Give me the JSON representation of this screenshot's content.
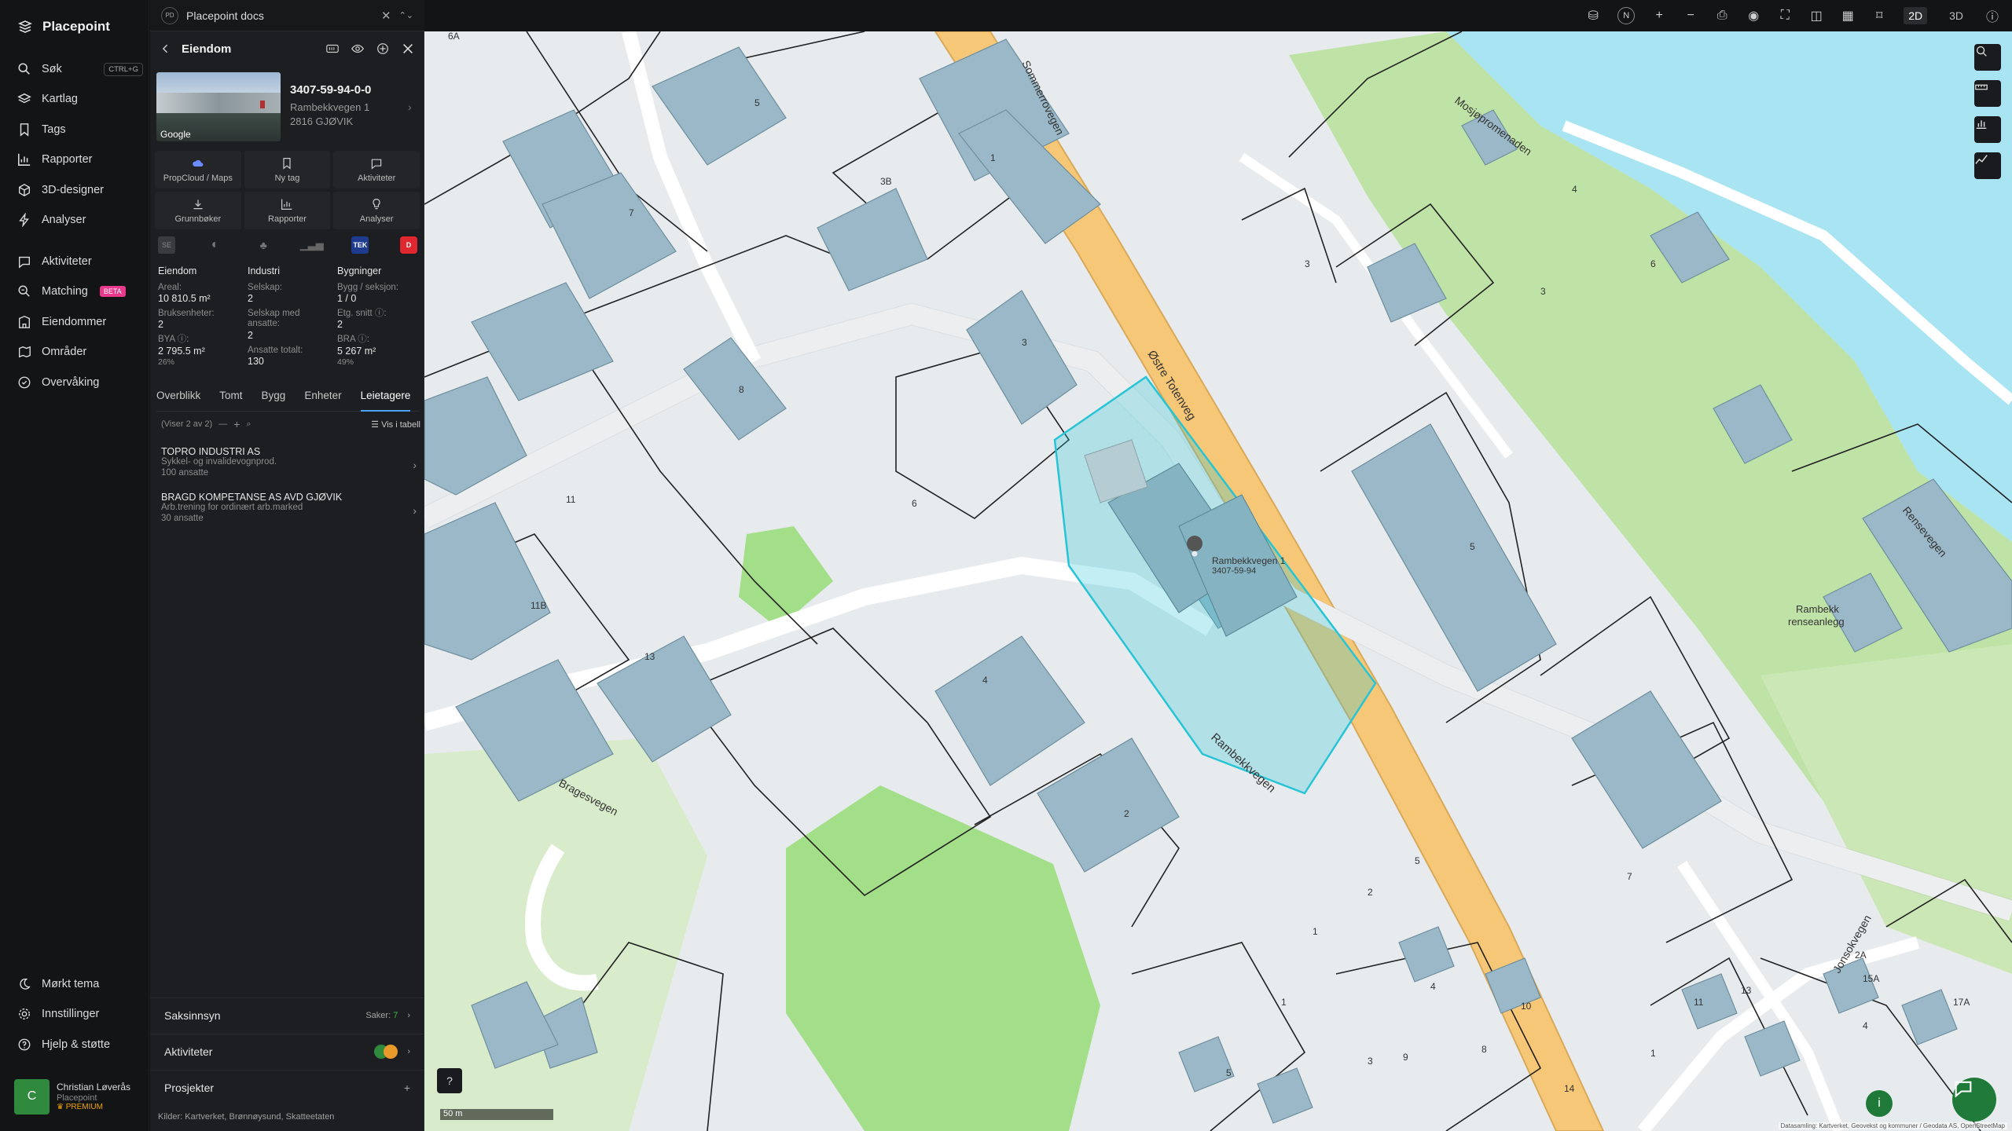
{
  "app": {
    "name": "Placepoint"
  },
  "nav": {
    "items": [
      {
        "label": "Søk",
        "icon": "search-icon",
        "shortcut": "CTRL+G"
      },
      {
        "label": "Kartlag",
        "icon": "layers-icon"
      },
      {
        "label": "Tags",
        "icon": "bookmark-icon"
      },
      {
        "label": "Rapporter",
        "icon": "chart-icon"
      },
      {
        "label": "3D-designer",
        "icon": "cube-icon"
      },
      {
        "label": "Analyser",
        "icon": "lightning-icon"
      },
      {
        "label": "Aktiviteter",
        "icon": "activity-icon"
      },
      {
        "label": "Matching",
        "icon": "matching-icon",
        "badge": "BETA"
      },
      {
        "label": "Eiendommer",
        "icon": "building-icon"
      },
      {
        "label": "Områder",
        "icon": "area-icon"
      },
      {
        "label": "Overvåking",
        "icon": "monitor-icon"
      }
    ],
    "bottom": [
      {
        "label": "Mørkt tema",
        "icon": "moon-icon"
      },
      {
        "label": "Innstillinger",
        "icon": "gear-icon"
      },
      {
        "label": "Hjelp & støtte",
        "icon": "help-icon"
      }
    ],
    "user": {
      "initial": "C",
      "name": "Christian Løverås",
      "org": "Placepoint",
      "plan": "PREMIUM"
    }
  },
  "panel": {
    "workspace": {
      "badge": "PD",
      "title": "Placepoint docs"
    },
    "header": {
      "title": "Eiendom"
    },
    "thumbnail": {
      "provider": "Google"
    },
    "property": {
      "id": "3407-59-94-0-0",
      "address": "Rambekkvegen 1",
      "postal": "2816 GJØVIK"
    },
    "actions": [
      {
        "label": "PropCloud / Maps",
        "icon": "cloud-icon"
      },
      {
        "label": "Ny tag",
        "icon": "bookmark-icon"
      },
      {
        "label": "Aktiviteter",
        "icon": "chat-icon"
      },
      {
        "label": "Grunnbøker",
        "icon": "download-icon"
      },
      {
        "label": "Rapporter",
        "icon": "chart-icon"
      },
      {
        "label": "Analyser",
        "icon": "lightbulb-icon"
      }
    ],
    "sources": {
      "tek": "TEK",
      "d": "D"
    },
    "facts": {
      "eiendom": {
        "title": "Eiendom",
        "areal_label": "Areal:",
        "areal_value": "10 810.5 m²",
        "bruksenheter_label": "Bruksenheter:",
        "bruksenheter_value": "2",
        "bya_label": "BYA ⓘ:",
        "bya_value": "2 795.5 m²",
        "bya_pct": "26%"
      },
      "industri": {
        "title": "Industri",
        "selskap_label": "Selskap:",
        "selskap_value": "2",
        "selskap_ansatte_label": "Selskap med ansatte:",
        "selskap_ansatte_value": "2",
        "ansatte_label": "Ansatte totalt:",
        "ansatte_value": "130"
      },
      "bygninger": {
        "title": "Bygninger",
        "bygg_label": "Bygg / seksjon:",
        "bygg_value": "1 / 0",
        "etg_label": "Etg. snitt ⓘ:",
        "etg_value": "2",
        "bra_label": "BRA ⓘ:",
        "bra_value": "5 267 m²",
        "bra_pct": "49%"
      }
    },
    "tabs": [
      "Overblikk",
      "Tomt",
      "Bygg",
      "Enheter",
      "Leietagere"
    ],
    "active_tab": "Leietagere",
    "list": {
      "count": "(Viser 2 av 2)",
      "table_link": "Vis i tabell"
    },
    "tenants": [
      {
        "name": "TOPRO INDUSTRI AS",
        "desc": "Sykkel- og invalidevognprod.",
        "employees": "100 ansatte"
      },
      {
        "name": "BRAGD KOMPETANSE AS AVD GJØVIK",
        "desc": "Arb.trening for ordinært arb.marked",
        "employees": "30 ansatte"
      }
    ],
    "sections": {
      "saksinnsyn": {
        "label": "Saksinnsyn",
        "count_label": "Saker:",
        "count": "7"
      },
      "aktiviteter": {
        "label": "Aktiviteter"
      },
      "prosjekter": {
        "label": "Prosjekter"
      }
    },
    "footer": {
      "label": "Kilder:",
      "sources": [
        "Kartverket,",
        "Brønnøysund,",
        "Skatteetaten"
      ]
    }
  },
  "topbar": {
    "north": "N",
    "mode_2d": "2D",
    "mode_3d": "3D"
  },
  "map": {
    "scale": "50 m",
    "attribution": "Datasamling: Kartverket, Geovekst og kommuner / Geodata AS, OpenStreetMap",
    "roads": [
      "Østre Totenveg",
      "Rambekkvegen",
      "Sommerrovegen",
      "Bragesvegen",
      "Mosjøpromenaden",
      "Rensevegen",
      "Jonsokvegen"
    ],
    "selected_label": "Rambekkvegen 1",
    "selected_sublabel": "3407-59-94",
    "place_label_1": "Rambekk",
    "place_label_2": "renseanlegg",
    "house_numbers": [
      "5",
      "7",
      "3B",
      "8",
      "6",
      "11",
      "11B",
      "13",
      "4",
      "2",
      "1",
      "3",
      "5",
      "1",
      "3",
      "6A",
      "4",
      "6",
      "3",
      "5",
      "7",
      "2",
      "4",
      "1",
      "10",
      "8",
      "9",
      "11",
      "13",
      "14",
      "15A",
      "17A",
      "4",
      "2A",
      "3",
      "5",
      "1"
    ],
    "colors": {
      "building": "#9ab8c7",
      "selected": "#27c4d6",
      "road_main": "#f6c776",
      "green": "#a8dc8a",
      "water": "#a8e4f4"
    }
  }
}
